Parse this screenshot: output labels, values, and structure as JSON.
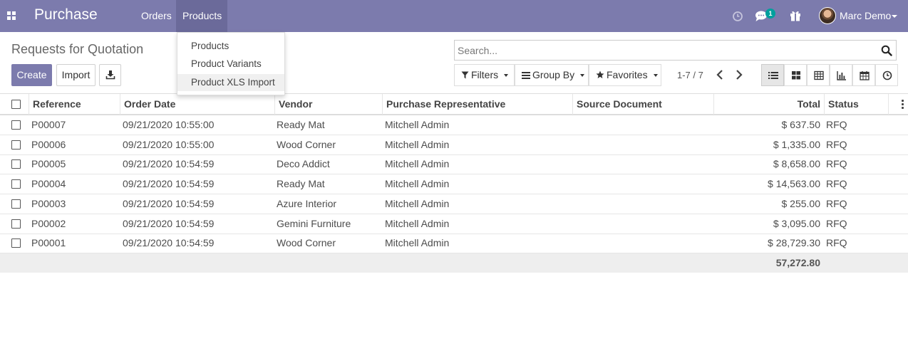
{
  "navbar": {
    "app_name": "Purchase",
    "menu": [
      "Orders",
      "Products"
    ],
    "chat_badge": "1",
    "user_name": "Marc Demo"
  },
  "products_menu": [
    "Products",
    "Product Variants",
    "Product XLS Import"
  ],
  "control_panel": {
    "title": "Requests for Quotation",
    "create_label": "Create",
    "import_label": "Import",
    "search_placeholder": "Search...",
    "filters_label": "Filters",
    "group_by_label": "Group By",
    "favorites_label": "Favorites",
    "pager": "1-7 / 7"
  },
  "table": {
    "columns": [
      "Reference",
      "Order Date",
      "Vendor",
      "Purchase Representative",
      "Source Document",
      "Total",
      "Status"
    ],
    "rows": [
      {
        "reference": "P00007",
        "order_date": "09/21/2020 10:55:00",
        "vendor": "Ready Mat",
        "representative": "Mitchell Admin",
        "source": "",
        "total": "$ 637.50",
        "status": "RFQ"
      },
      {
        "reference": "P00006",
        "order_date": "09/21/2020 10:55:00",
        "vendor": "Wood Corner",
        "representative": "Mitchell Admin",
        "source": "",
        "total": "$ 1,335.00",
        "status": "RFQ"
      },
      {
        "reference": "P00005",
        "order_date": "09/21/2020 10:54:59",
        "vendor": "Deco Addict",
        "representative": "Mitchell Admin",
        "source": "",
        "total": "$ 8,658.00",
        "status": "RFQ"
      },
      {
        "reference": "P00004",
        "order_date": "09/21/2020 10:54:59",
        "vendor": "Ready Mat",
        "representative": "Mitchell Admin",
        "source": "",
        "total": "$ 14,563.00",
        "status": "RFQ"
      },
      {
        "reference": "P00003",
        "order_date": "09/21/2020 10:54:59",
        "vendor": "Azure Interior",
        "representative": "Mitchell Admin",
        "source": "",
        "total": "$ 255.00",
        "status": "RFQ"
      },
      {
        "reference": "P00002",
        "order_date": "09/21/2020 10:54:59",
        "vendor": "Gemini Furniture",
        "representative": "Mitchell Admin",
        "source": "",
        "total": "$ 3,095.00",
        "status": "RFQ"
      },
      {
        "reference": "P00001",
        "order_date": "09/21/2020 10:54:59",
        "vendor": "Wood Corner",
        "representative": "Mitchell Admin",
        "source": "",
        "total": "$ 28,729.30",
        "status": "RFQ"
      }
    ],
    "grand_total": "57,272.80"
  },
  "colors": {
    "brand": "#7c7bad",
    "brand_active": "#6b6a9a",
    "badge": "#00a09d"
  },
  "icons": [
    "apps-icon",
    "activity-clock-icon",
    "chat-icon",
    "gift-icon",
    "download-icon",
    "search-icon",
    "filter-icon",
    "group-by-icon",
    "star-icon",
    "chevron-left-icon",
    "chevron-right-icon",
    "list-view-icon",
    "kanban-view-icon",
    "pivot-view-icon",
    "graph-view-icon",
    "calendar-view-icon",
    "activity-view-icon",
    "column-options-icon"
  ]
}
